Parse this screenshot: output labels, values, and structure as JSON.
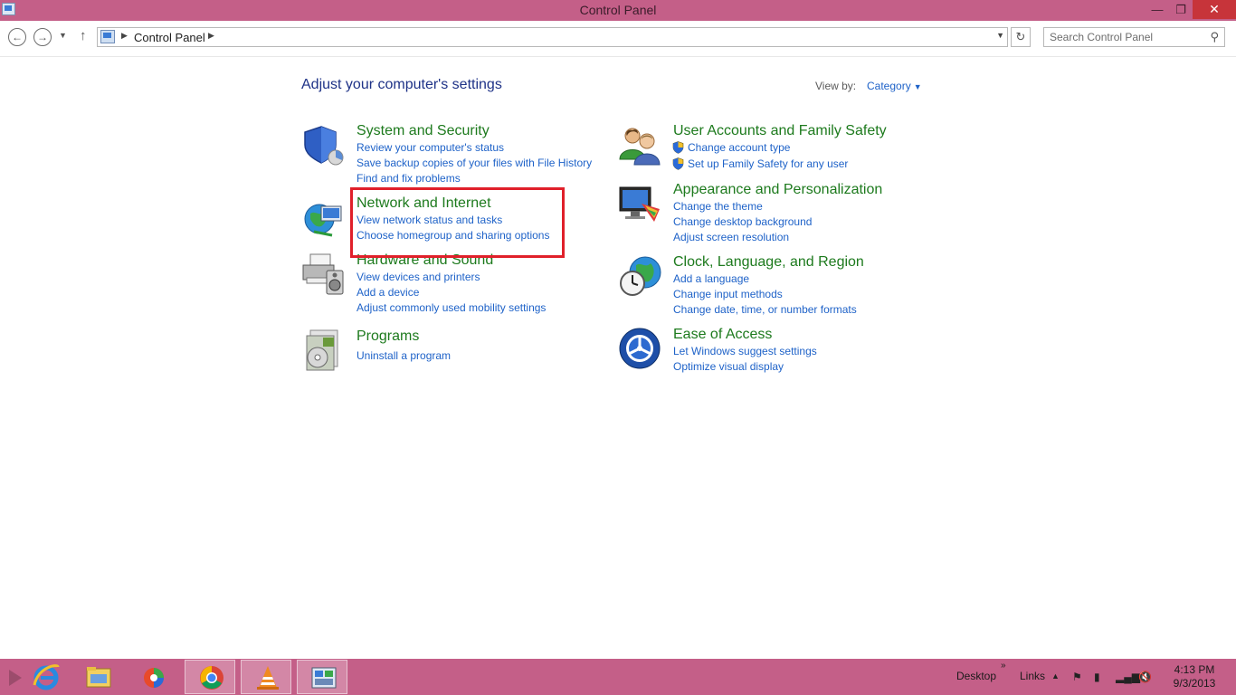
{
  "window": {
    "title": "Control Panel",
    "minimize": "—",
    "maximize": "❐",
    "close": "✕"
  },
  "nav": {
    "breadcrumb": "Control Panel",
    "search_placeholder": "Search Control Panel"
  },
  "main": {
    "heading": "Adjust your computer's settings",
    "view_by_label": "View by:",
    "view_by_value": "Category"
  },
  "categories": [
    {
      "title": "System and Security",
      "icon": "shield-icon",
      "links": [
        "Review your computer's status",
        "Save backup copies of your files with File History",
        "Find and fix problems"
      ]
    },
    {
      "title": "Network and Internet",
      "icon": "network-globe-icon",
      "links": [
        "View network status and tasks",
        "Choose homegroup and sharing options"
      ]
    },
    {
      "title": "Hardware and Sound",
      "icon": "printer-speaker-icon",
      "links": [
        "View devices and printers",
        "Add a device",
        "Adjust commonly used mobility settings"
      ]
    },
    {
      "title": "Programs",
      "icon": "programs-icon",
      "links": [
        "Uninstall a program"
      ]
    },
    {
      "title": "User Accounts and Family Safety",
      "icon": "users-icon",
      "links": [
        "Change account type",
        "Set up Family Safety for any user"
      ]
    },
    {
      "title": "Appearance and Personalization",
      "icon": "monitor-palette-icon",
      "links": [
        "Change the theme",
        "Change desktop background",
        "Adjust screen resolution"
      ]
    },
    {
      "title": "Clock, Language, and Region",
      "icon": "clock-globe-icon",
      "links": [
        "Add a language",
        "Change input methods",
        "Change date, time, or number formats"
      ]
    },
    {
      "title": "Ease of Access",
      "icon": "ease-of-access-icon",
      "links": [
        "Let Windows suggest settings",
        "Optimize visual display"
      ]
    }
  ],
  "taskbar": {
    "apps": [
      "internet-explorer-icon",
      "file-explorer-icon",
      "media-icon",
      "chrome-icon",
      "vlc-icon",
      "control-panel-icon"
    ],
    "desktop_label": "Desktop",
    "links_label": "Links",
    "time": "4:13 PM",
    "date": "9/3/2013"
  },
  "colors": {
    "accent_bar": "#c45f88",
    "heading_blue": "#1e3287",
    "category_green": "#1d7a1d",
    "link_blue": "#1e62c8",
    "highlight_red": "#e0202a"
  }
}
